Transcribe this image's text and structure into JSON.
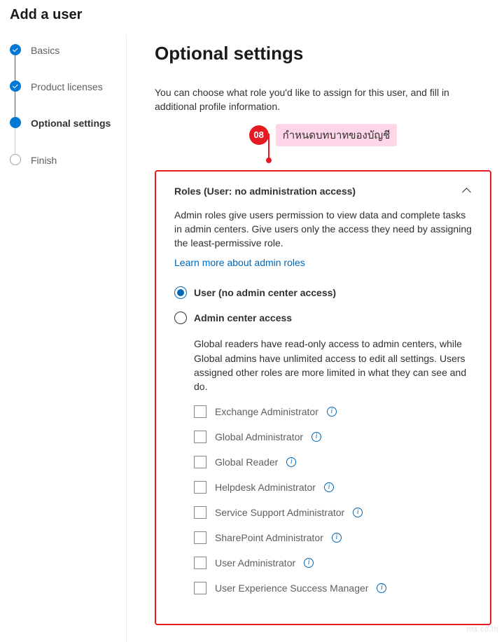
{
  "page": {
    "title": "Add a user",
    "watermark": "nts.co.th"
  },
  "stepper": {
    "items": [
      {
        "label": "Basics",
        "state": "done"
      },
      {
        "label": "Product licenses",
        "state": "done"
      },
      {
        "label": "Optional settings",
        "state": "current"
      },
      {
        "label": "Finish",
        "state": "pending"
      }
    ]
  },
  "main": {
    "title": "Optional settings",
    "description": "You can choose what role you'd like to assign for this user, and fill in additional profile information."
  },
  "callout": {
    "badge": "08",
    "text": "กำหนดบทบาทของบัญชี"
  },
  "roles": {
    "header": "Roles (User: no administration access)",
    "description": "Admin roles give users permission to view data and complete tasks in admin centers. Give users only the access they need by assigning the least-permissive role.",
    "learn_more": "Learn more about admin roles",
    "options": {
      "user_label": "User (no admin center access)",
      "admin_label": "Admin center access"
    },
    "admin_description": "Global readers have read-only access to admin centers, while Global admins have unlimited access to edit all settings. Users assigned other roles are more limited in what they can see and do.",
    "admin_roles": [
      "Exchange Administrator",
      "Global Administrator",
      "Global Reader",
      "Helpdesk Administrator",
      "Service Support Administrator",
      "SharePoint Administrator",
      "User Administrator",
      "User Experience Success Manager"
    ]
  }
}
